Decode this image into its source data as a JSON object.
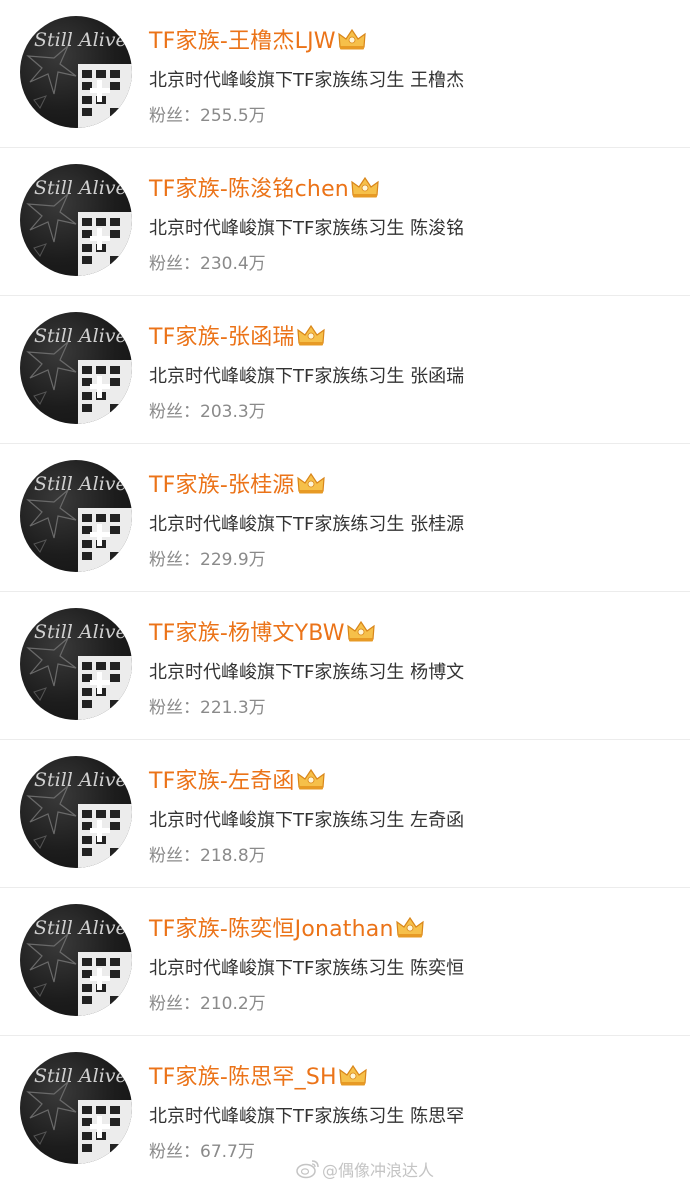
{
  "accounts": [
    {
      "name": "TF家族-王橹杰LJW",
      "bio": "北京时代峰峻旗下TF家族练习生 王橹杰",
      "fans_label": "粉丝：",
      "fans": "255.5万",
      "avatar_text": "Still Alive"
    },
    {
      "name": "TF家族-陈浚铭chen",
      "bio": "北京时代峰峻旗下TF家族练习生 陈浚铭",
      "fans_label": "粉丝：",
      "fans": "230.4万",
      "avatar_text": "Still Alive"
    },
    {
      "name": "TF家族-张函瑞",
      "bio": "北京时代峰峻旗下TF家族练习生 张函瑞",
      "fans_label": "粉丝：",
      "fans": "203.3万",
      "avatar_text": "Still Alive"
    },
    {
      "name": "TF家族-张桂源",
      "bio": "北京时代峰峻旗下TF家族练习生 张桂源",
      "fans_label": "粉丝：",
      "fans": "229.9万",
      "avatar_text": "Still Alive"
    },
    {
      "name": "TF家族-杨博文YBW",
      "bio": "北京时代峰峻旗下TF家族练习生 杨博文",
      "fans_label": "粉丝：",
      "fans": "221.3万",
      "avatar_text": "Still Alive"
    },
    {
      "name": "TF家族-左奇函",
      "bio": "北京时代峰峻旗下TF家族练习生 左奇函",
      "fans_label": "粉丝：",
      "fans": "218.8万",
      "avatar_text": "Still Alive"
    },
    {
      "name": "TF家族-陈奕恒Jonathan",
      "bio": "北京时代峰峻旗下TF家族练习生 陈奕恒",
      "fans_label": "粉丝：",
      "fans": "210.2万",
      "avatar_text": "Still Alive"
    },
    {
      "name": "TF家族-陈思罕_SH",
      "bio": "北京时代峰峻旗下TF家族练习生 陈思罕",
      "fans_label": "粉丝：",
      "fans": "67.7万",
      "avatar_text": "Still Alive"
    }
  ],
  "watermark": {
    "text": "@偶像冲浪达人",
    "icon": "weibo-icon"
  },
  "colors": {
    "name": "#eb7318",
    "bio": "#333333",
    "fans": "#8a8a8a",
    "crown": "#f0a020",
    "divider": "#ececec"
  }
}
